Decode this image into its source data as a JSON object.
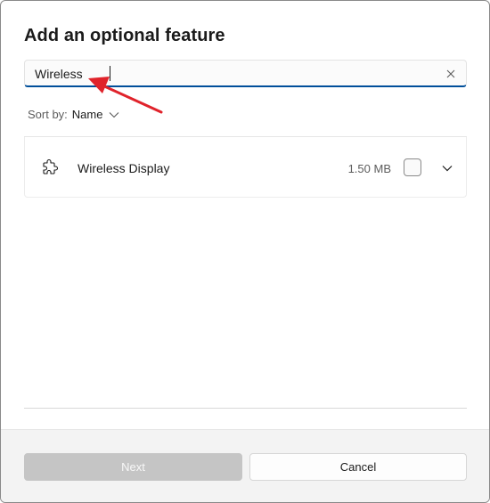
{
  "dialog": {
    "title": "Add an optional feature"
  },
  "search": {
    "value": "Wireless",
    "clear_icon": "close-icon"
  },
  "sort": {
    "label": "Sort by:",
    "value": "Name",
    "icon": "chevron-down-icon"
  },
  "features": [
    {
      "name": "Wireless Display",
      "size": "1.50 MB",
      "checked": false,
      "icon": "puzzle-icon"
    }
  ],
  "footer": {
    "next_label": "Next",
    "cancel_label": "Cancel"
  },
  "colors": {
    "accent": "#004f9a",
    "annotation_arrow": "#e0232b",
    "disabled_button": "#c5c5c5"
  }
}
